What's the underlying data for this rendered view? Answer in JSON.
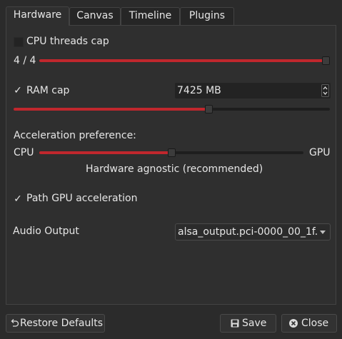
{
  "tabs": [
    {
      "label": "Hardware",
      "active": true
    },
    {
      "label": "Canvas",
      "active": false
    },
    {
      "label": "Timeline",
      "active": false
    },
    {
      "label": "Plugins",
      "active": false
    }
  ],
  "cpu_threads": {
    "label": "CPU threads cap",
    "checked": false,
    "readout": "4 / 4",
    "value": 4,
    "max": 4
  },
  "ram": {
    "label": "RAM cap",
    "checked": true,
    "check_glyph": "✓",
    "value_text": "7425 MB",
    "slider_fraction": 0.62
  },
  "acceleration": {
    "heading": "Acceleration preference:",
    "min_label": "CPU",
    "max_label": "GPU",
    "caption": "Hardware agnostic (recommended)",
    "slider_fraction": 0.5
  },
  "path_gpu": {
    "label": "Path GPU acceleration",
    "checked": true,
    "check_glyph": "✓"
  },
  "audio_output": {
    "label": "Audio Output",
    "selected": "alsa_output.pci-0000_00_1f."
  },
  "buttons": {
    "restore_defaults": "Restore Defaults",
    "save": "Save",
    "close": "Close"
  },
  "colors": {
    "background": "#2b2b2b",
    "panel": "#2f2f2f",
    "accent_red": "#c0272d",
    "text": "#e6e6e6"
  },
  "icons": {
    "restore": "undo-icon",
    "save": "save-icon",
    "close": "close-circle-icon",
    "combo": "chevron-down-icon",
    "spin_up": "spin-up-icon",
    "spin_down": "spin-down-icon"
  }
}
